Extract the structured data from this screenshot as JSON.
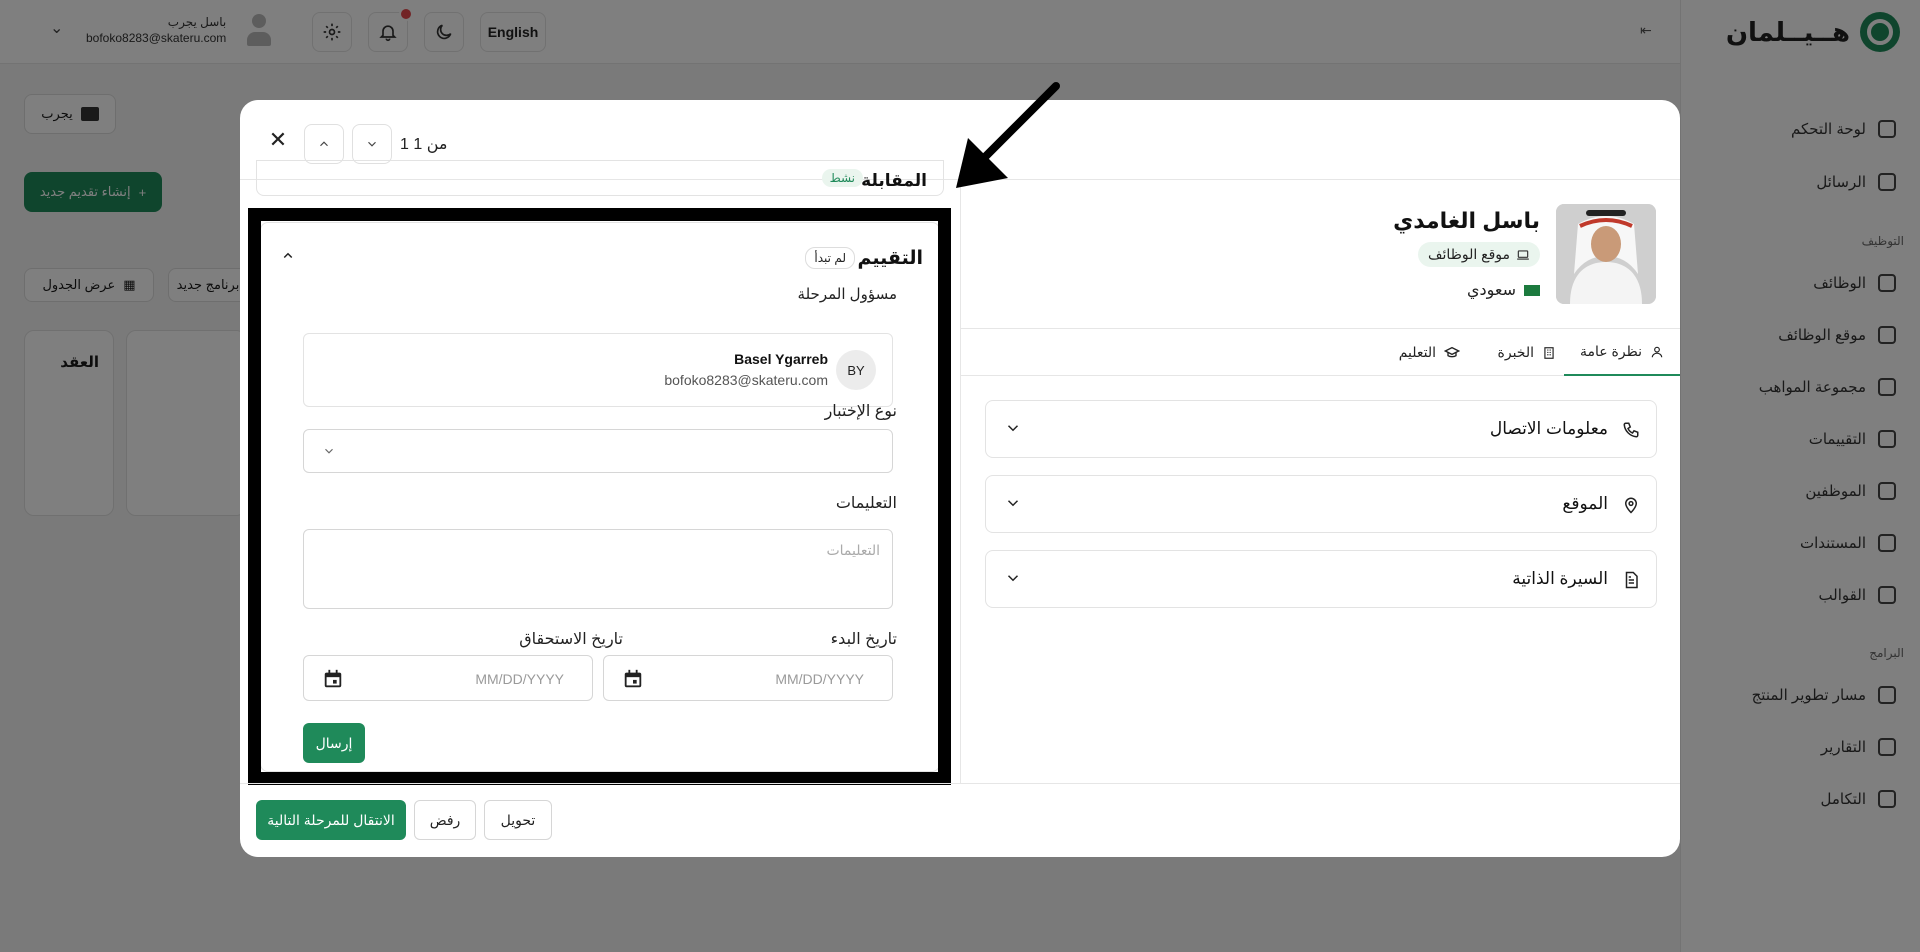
{
  "app": {
    "logo_text": "هــيــلمان",
    "language_button": "English",
    "user": {
      "name": "باسل يجرب",
      "email": "bofoko8283@skateru.com"
    },
    "page_actions": {
      "try_label": "يجرب",
      "create_application": "إنشاء تقديم جديد",
      "view_table": "عرض الجدول",
      "new_program": "برنامج جديد",
      "column_title": "العقد"
    },
    "sidebar": {
      "section_jobs": "التوظيف",
      "section_programs": "البرامج",
      "items": [
        {
          "label": "لوحة التحكم"
        },
        {
          "label": "الرسائل"
        },
        {
          "label": "الوظائف"
        },
        {
          "label": "موقع الوظائف"
        },
        {
          "label": "مجموعة المواهب"
        },
        {
          "label": "التقييمات"
        },
        {
          "label": "الموظفين"
        },
        {
          "label": "المستندات"
        },
        {
          "label": "القوالب"
        },
        {
          "label": "مسار تطوير المنتج"
        },
        {
          "label": "التقارير"
        },
        {
          "label": "التكامل"
        }
      ]
    }
  },
  "modal": {
    "pager": "1 من 1",
    "candidate": {
      "name": "باسل الغامدي",
      "source": "موقع الوظائف",
      "nationality": "سعودي"
    },
    "tabs": [
      {
        "label": "نظرة عامة",
        "icon": "user-icon",
        "active": true
      },
      {
        "label": "الخبرة",
        "icon": "building-icon",
        "active": false
      },
      {
        "label": "التعليم",
        "icon": "graduation-cap-icon",
        "active": false
      }
    ],
    "sections": [
      {
        "label": "معلومات الاتصال",
        "icon": "phone-icon"
      },
      {
        "label": "الموقع",
        "icon": "map-pin-icon"
      },
      {
        "label": "السيرة الذاتية",
        "icon": "file-text-icon"
      }
    ],
    "previous_stage": {
      "label": "المقابلة",
      "status": "نشط"
    },
    "assessment": {
      "title": "التقييم",
      "status": "لم تبدأ",
      "owner_label": "مسؤول المرحلة",
      "owner": {
        "initials": "BY",
        "name": "Basel Ygarreb",
        "email": "bofoko8283@skateru.com"
      },
      "test_type_label": "نوع الإختبار",
      "test_type_value": "",
      "instructions_label": "التعليمات",
      "instructions_placeholder": "التعليمات",
      "start_date_label": "تاريخ البدء",
      "start_date_placeholder": "MM/DD/YYYY",
      "due_date_label": "تاريخ الاستحقاق",
      "due_date_placeholder": "MM/DD/YYYY",
      "submit_label": "إرسال"
    },
    "footer": {
      "next_stage": "الانتقال للمرحلة التالية",
      "reject": "رفض",
      "transfer": "تحويل"
    }
  },
  "colors": {
    "brand_green": "#1f8a5a",
    "overlay": "rgba(0,0,0,0.5)",
    "highlight_border": "#000000",
    "notification_dot": "#e5484d"
  }
}
